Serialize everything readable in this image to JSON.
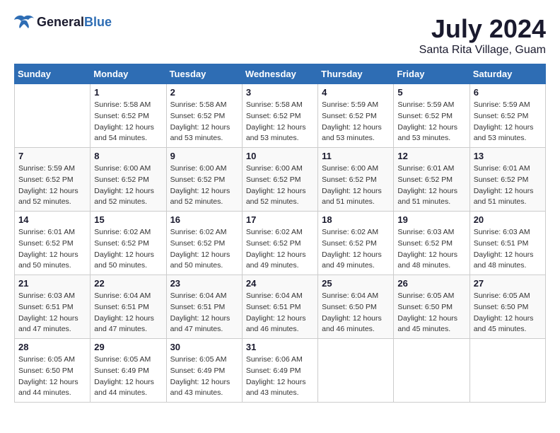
{
  "header": {
    "logo_general": "General",
    "logo_blue": "Blue",
    "month_year": "July 2024",
    "location": "Santa Rita Village, Guam"
  },
  "days_of_week": [
    "Sunday",
    "Monday",
    "Tuesday",
    "Wednesday",
    "Thursday",
    "Friday",
    "Saturday"
  ],
  "weeks": [
    [
      {
        "day": "",
        "info": ""
      },
      {
        "day": "1",
        "info": "Sunrise: 5:58 AM\nSunset: 6:52 PM\nDaylight: 12 hours\nand 54 minutes."
      },
      {
        "day": "2",
        "info": "Sunrise: 5:58 AM\nSunset: 6:52 PM\nDaylight: 12 hours\nand 53 minutes."
      },
      {
        "day": "3",
        "info": "Sunrise: 5:58 AM\nSunset: 6:52 PM\nDaylight: 12 hours\nand 53 minutes."
      },
      {
        "day": "4",
        "info": "Sunrise: 5:59 AM\nSunset: 6:52 PM\nDaylight: 12 hours\nand 53 minutes."
      },
      {
        "day": "5",
        "info": "Sunrise: 5:59 AM\nSunset: 6:52 PM\nDaylight: 12 hours\nand 53 minutes."
      },
      {
        "day": "6",
        "info": "Sunrise: 5:59 AM\nSunset: 6:52 PM\nDaylight: 12 hours\nand 53 minutes."
      }
    ],
    [
      {
        "day": "7",
        "info": "Sunrise: 5:59 AM\nSunset: 6:52 PM\nDaylight: 12 hours\nand 52 minutes."
      },
      {
        "day": "8",
        "info": "Sunrise: 6:00 AM\nSunset: 6:52 PM\nDaylight: 12 hours\nand 52 minutes."
      },
      {
        "day": "9",
        "info": "Sunrise: 6:00 AM\nSunset: 6:52 PM\nDaylight: 12 hours\nand 52 minutes."
      },
      {
        "day": "10",
        "info": "Sunrise: 6:00 AM\nSunset: 6:52 PM\nDaylight: 12 hours\nand 52 minutes."
      },
      {
        "day": "11",
        "info": "Sunrise: 6:00 AM\nSunset: 6:52 PM\nDaylight: 12 hours\nand 51 minutes."
      },
      {
        "day": "12",
        "info": "Sunrise: 6:01 AM\nSunset: 6:52 PM\nDaylight: 12 hours\nand 51 minutes."
      },
      {
        "day": "13",
        "info": "Sunrise: 6:01 AM\nSunset: 6:52 PM\nDaylight: 12 hours\nand 51 minutes."
      }
    ],
    [
      {
        "day": "14",
        "info": "Sunrise: 6:01 AM\nSunset: 6:52 PM\nDaylight: 12 hours\nand 50 minutes."
      },
      {
        "day": "15",
        "info": "Sunrise: 6:02 AM\nSunset: 6:52 PM\nDaylight: 12 hours\nand 50 minutes."
      },
      {
        "day": "16",
        "info": "Sunrise: 6:02 AM\nSunset: 6:52 PM\nDaylight: 12 hours\nand 50 minutes."
      },
      {
        "day": "17",
        "info": "Sunrise: 6:02 AM\nSunset: 6:52 PM\nDaylight: 12 hours\nand 49 minutes."
      },
      {
        "day": "18",
        "info": "Sunrise: 6:02 AM\nSunset: 6:52 PM\nDaylight: 12 hours\nand 49 minutes."
      },
      {
        "day": "19",
        "info": "Sunrise: 6:03 AM\nSunset: 6:52 PM\nDaylight: 12 hours\nand 48 minutes."
      },
      {
        "day": "20",
        "info": "Sunrise: 6:03 AM\nSunset: 6:51 PM\nDaylight: 12 hours\nand 48 minutes."
      }
    ],
    [
      {
        "day": "21",
        "info": "Sunrise: 6:03 AM\nSunset: 6:51 PM\nDaylight: 12 hours\nand 47 minutes."
      },
      {
        "day": "22",
        "info": "Sunrise: 6:04 AM\nSunset: 6:51 PM\nDaylight: 12 hours\nand 47 minutes."
      },
      {
        "day": "23",
        "info": "Sunrise: 6:04 AM\nSunset: 6:51 PM\nDaylight: 12 hours\nand 47 minutes."
      },
      {
        "day": "24",
        "info": "Sunrise: 6:04 AM\nSunset: 6:51 PM\nDaylight: 12 hours\nand 46 minutes."
      },
      {
        "day": "25",
        "info": "Sunrise: 6:04 AM\nSunset: 6:50 PM\nDaylight: 12 hours\nand 46 minutes."
      },
      {
        "day": "26",
        "info": "Sunrise: 6:05 AM\nSunset: 6:50 PM\nDaylight: 12 hours\nand 45 minutes."
      },
      {
        "day": "27",
        "info": "Sunrise: 6:05 AM\nSunset: 6:50 PM\nDaylight: 12 hours\nand 45 minutes."
      }
    ],
    [
      {
        "day": "28",
        "info": "Sunrise: 6:05 AM\nSunset: 6:50 PM\nDaylight: 12 hours\nand 44 minutes."
      },
      {
        "day": "29",
        "info": "Sunrise: 6:05 AM\nSunset: 6:49 PM\nDaylight: 12 hours\nand 44 minutes."
      },
      {
        "day": "30",
        "info": "Sunrise: 6:05 AM\nSunset: 6:49 PM\nDaylight: 12 hours\nand 43 minutes."
      },
      {
        "day": "31",
        "info": "Sunrise: 6:06 AM\nSunset: 6:49 PM\nDaylight: 12 hours\nand 43 minutes."
      },
      {
        "day": "",
        "info": ""
      },
      {
        "day": "",
        "info": ""
      },
      {
        "day": "",
        "info": ""
      }
    ]
  ]
}
